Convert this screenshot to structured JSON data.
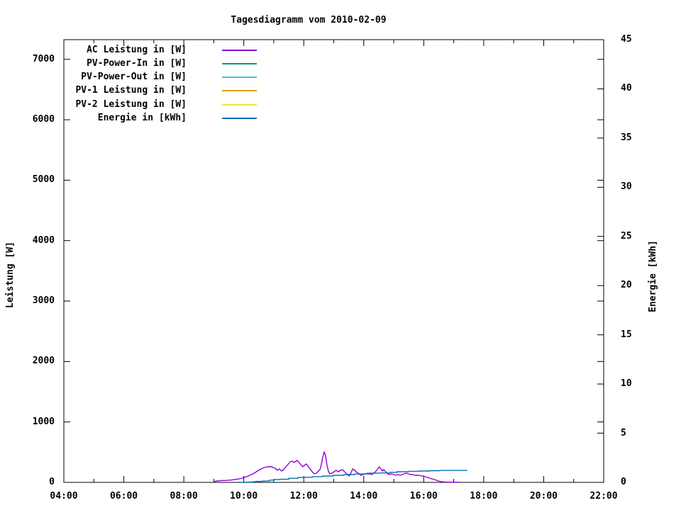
{
  "title": "Tagesdiagramm vom 2010-02-09",
  "axes": {
    "x": {
      "min": 4,
      "max": 22,
      "major_ticks": [
        {
          "v": 4,
          "label": "04:00"
        },
        {
          "v": 6,
          "label": "06:00"
        },
        {
          "v": 8,
          "label": "08:00"
        },
        {
          "v": 10,
          "label": "10:00"
        },
        {
          "v": 12,
          "label": "12:00"
        },
        {
          "v": 14,
          "label": "14:00"
        },
        {
          "v": 16,
          "label": "16:00"
        },
        {
          "v": 18,
          "label": "18:00"
        },
        {
          "v": 20,
          "label": "20:00"
        },
        {
          "v": 22,
          "label": "22:00"
        }
      ],
      "minor_ticks": [
        5,
        7,
        9,
        11,
        13,
        15,
        17,
        19,
        21
      ]
    },
    "y1": {
      "label": "Leistung [W]",
      "min": 0,
      "max": 7325,
      "major_ticks": [
        {
          "v": 0,
          "label": "0"
        },
        {
          "v": 1000,
          "label": "1000"
        },
        {
          "v": 2000,
          "label": "2000"
        },
        {
          "v": 3000,
          "label": "3000"
        },
        {
          "v": 4000,
          "label": "4000"
        },
        {
          "v": 5000,
          "label": "5000"
        },
        {
          "v": 6000,
          "label": "6000"
        },
        {
          "v": 7000,
          "label": "7000"
        }
      ]
    },
    "y2": {
      "label": "Energie [kWh]",
      "min": 0,
      "max": 45,
      "major_ticks": [
        {
          "v": 0,
          "label": "0"
        },
        {
          "v": 5,
          "label": "5"
        },
        {
          "v": 10,
          "label": "10"
        },
        {
          "v": 15,
          "label": "15"
        },
        {
          "v": 20,
          "label": "20"
        },
        {
          "v": 25,
          "label": "25"
        },
        {
          "v": 30,
          "label": "30"
        },
        {
          "v": 35,
          "label": "35"
        },
        {
          "v": 40,
          "label": "40"
        },
        {
          "v": 45,
          "label": "45"
        }
      ]
    }
  },
  "chart_data": {
    "type": "line",
    "title": "Tagesdiagramm vom 2010-02-09",
    "xlabel": "",
    "x_unit": "hour_of_day",
    "xlim": [
      4,
      22
    ],
    "ylabel_left": "Leistung [W]",
    "ylim_left": [
      0,
      7325
    ],
    "ylabel_right": "Energie [kWh]",
    "ylim_right": [
      0,
      45
    ],
    "grid": false,
    "legend_position": "top-left-inside",
    "series": [
      {
        "name": "AC Leistung in [W]",
        "color": "#9400d3",
        "axis": "y1",
        "style": "line",
        "points": [
          [
            8.99,
            10
          ],
          [
            9.1,
            22
          ],
          [
            9.25,
            30
          ],
          [
            9.45,
            33
          ],
          [
            9.6,
            40
          ],
          [
            9.75,
            50
          ],
          [
            9.85,
            60
          ],
          [
            9.95,
            70
          ],
          [
            10.03,
            82
          ],
          [
            10.12,
            100
          ],
          [
            10.2,
            117
          ],
          [
            10.3,
            140
          ],
          [
            10.4,
            170
          ],
          [
            10.5,
            200
          ],
          [
            10.58,
            223
          ],
          [
            10.69,
            246
          ],
          [
            10.78,
            258
          ],
          [
            10.93,
            258
          ],
          [
            11.0,
            240
          ],
          [
            11.05,
            234
          ],
          [
            11.12,
            199
          ],
          [
            11.19,
            223
          ],
          [
            11.26,
            188
          ],
          [
            11.33,
            211
          ],
          [
            11.4,
            258
          ],
          [
            11.47,
            293
          ],
          [
            11.54,
            340
          ],
          [
            11.62,
            352
          ],
          [
            11.66,
            328
          ],
          [
            11.71,
            340
          ],
          [
            11.78,
            363
          ],
          [
            11.83,
            340
          ],
          [
            11.9,
            293
          ],
          [
            11.97,
            258
          ],
          [
            12.02,
            281
          ],
          [
            12.09,
            305
          ],
          [
            12.14,
            270
          ],
          [
            12.21,
            223
          ],
          [
            12.28,
            176
          ],
          [
            12.35,
            141
          ],
          [
            12.42,
            152
          ],
          [
            12.49,
            188
          ],
          [
            12.54,
            211
          ],
          [
            12.58,
            281
          ],
          [
            12.63,
            410
          ],
          [
            12.68,
            504
          ],
          [
            12.71,
            470
          ],
          [
            12.73,
            434
          ],
          [
            12.77,
            293
          ],
          [
            12.82,
            188
          ],
          [
            12.87,
            141
          ],
          [
            12.94,
            152
          ],
          [
            13.01,
            176
          ],
          [
            13.08,
            199
          ],
          [
            13.15,
            176
          ],
          [
            13.22,
            199
          ],
          [
            13.29,
            211
          ],
          [
            13.36,
            176
          ],
          [
            13.44,
            141
          ],
          [
            13.51,
            105
          ],
          [
            13.58,
            164
          ],
          [
            13.63,
            223
          ],
          [
            13.7,
            199
          ],
          [
            13.77,
            164
          ],
          [
            13.84,
            141
          ],
          [
            13.91,
            117
          ],
          [
            13.98,
            129
          ],
          [
            14.05,
            141
          ],
          [
            14.12,
            152
          ],
          [
            14.19,
            141
          ],
          [
            14.26,
            129
          ],
          [
            14.34,
            152
          ],
          [
            14.41,
            188
          ],
          [
            14.48,
            234
          ],
          [
            14.52,
            258
          ],
          [
            14.57,
            223
          ],
          [
            14.62,
            188
          ],
          [
            14.66,
            211
          ],
          [
            14.71,
            188
          ],
          [
            14.78,
            152
          ],
          [
            14.85,
            129
          ],
          [
            14.93,
            141
          ],
          [
            15.0,
            129
          ],
          [
            15.07,
            117
          ],
          [
            15.14,
            129
          ],
          [
            15.21,
            117
          ],
          [
            15.28,
            129
          ],
          [
            15.35,
            141
          ],
          [
            15.42,
            152
          ],
          [
            15.49,
            141
          ],
          [
            15.56,
            129
          ],
          [
            15.63,
            129
          ],
          [
            15.71,
            117
          ],
          [
            15.78,
            117
          ],
          [
            15.85,
            117
          ],
          [
            15.92,
            105
          ],
          [
            15.99,
            105
          ],
          [
            16.06,
            94
          ],
          [
            16.13,
            82
          ],
          [
            16.2,
            70
          ],
          [
            16.27,
            59
          ],
          [
            16.35,
            47
          ],
          [
            16.42,
            35
          ],
          [
            16.49,
            23
          ],
          [
            16.58,
            12
          ],
          [
            16.7,
            6
          ],
          [
            16.9,
            4
          ],
          [
            17.1,
            3
          ],
          [
            17.2,
            2
          ]
        ]
      },
      {
        "name": "PV-Power-In in [W]",
        "color": "#009e73",
        "axis": "y1",
        "style": "line",
        "points": []
      },
      {
        "name": "PV-Power-Out in [W]",
        "color": "#56b4e9",
        "axis": "y1",
        "style": "line",
        "points": []
      },
      {
        "name": "PV-1 Leistung in [W]",
        "color": "#e69f00",
        "axis": "y1",
        "style": "line",
        "points": []
      },
      {
        "name": "PV-2 Leistung in [W]",
        "color": "#f0e442",
        "axis": "y1",
        "style": "line",
        "points": []
      },
      {
        "name": "Energie in [kWh]",
        "color": "#0072b2",
        "axis": "y2",
        "style": "steps",
        "points": [
          [
            9.84,
            0.0
          ],
          [
            10.1,
            0.03
          ],
          [
            10.3,
            0.06
          ],
          [
            10.39,
            0.1
          ],
          [
            10.62,
            0.14
          ],
          [
            10.86,
            0.22
          ],
          [
            11.0,
            0.28
          ],
          [
            11.21,
            0.32
          ],
          [
            11.5,
            0.42
          ],
          [
            11.8,
            0.5
          ],
          [
            12.0,
            0.52
          ],
          [
            12.28,
            0.58
          ],
          [
            12.63,
            0.65
          ],
          [
            12.99,
            0.72
          ],
          [
            13.34,
            0.79
          ],
          [
            13.7,
            0.86
          ],
          [
            14.17,
            0.94
          ],
          [
            14.52,
            0.96
          ],
          [
            14.88,
            1.02
          ],
          [
            15.11,
            1.08
          ],
          [
            15.5,
            1.12
          ],
          [
            15.82,
            1.15
          ],
          [
            16.2,
            1.19
          ],
          [
            16.53,
            1.22
          ],
          [
            17.0,
            1.22
          ],
          [
            17.45,
            1.22
          ]
        ]
      }
    ]
  }
}
